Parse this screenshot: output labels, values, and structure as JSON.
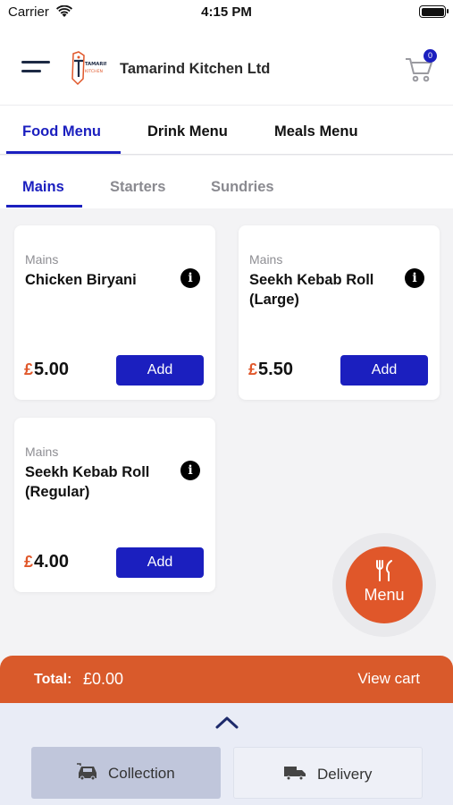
{
  "status_bar": {
    "carrier": "Carrier",
    "time": "4:15 PM"
  },
  "header": {
    "brand": "Tamarind Kitchen Ltd",
    "logo_text": "TAMARIND KITCHEN",
    "cart_count": "0"
  },
  "menu_tabs": [
    {
      "label": "Food Menu",
      "active": true
    },
    {
      "label": "Drink Menu",
      "active": false
    },
    {
      "label": "Meals Menu",
      "active": false
    }
  ],
  "sub_tabs": [
    {
      "label": "Mains",
      "active": true
    },
    {
      "label": "Starters",
      "active": false
    },
    {
      "label": "Sundries",
      "active": false
    }
  ],
  "items": [
    {
      "category": "Mains",
      "name": "Chicken Biryani",
      "currency": "£",
      "price": "5.00",
      "add_label": "Add",
      "info_icon": "i"
    },
    {
      "category": "Mains",
      "name": "Seekh Kebab Roll (Large)",
      "currency": "£",
      "price": "5.50",
      "add_label": "Add",
      "info_icon": "i"
    },
    {
      "category": "Mains",
      "name": "Seekh Kebab Roll (Regular)",
      "currency": "£",
      "price": "4.00",
      "add_label": "Add",
      "info_icon": "i"
    }
  ],
  "fab": {
    "label": "Menu",
    "icon": "fork-knife-icon"
  },
  "total_bar": {
    "label": "Total:",
    "value": "£0.00",
    "view_cart": "View cart"
  },
  "order_options": [
    {
      "label": "Collection",
      "icon": "collection-car-icon",
      "selected": true
    },
    {
      "label": "Delivery",
      "icon": "delivery-truck-icon",
      "selected": false
    }
  ],
  "colors": {
    "primary": "#1b1fbf",
    "accent": "#e0572a",
    "total_bar": "#d95a2b"
  }
}
